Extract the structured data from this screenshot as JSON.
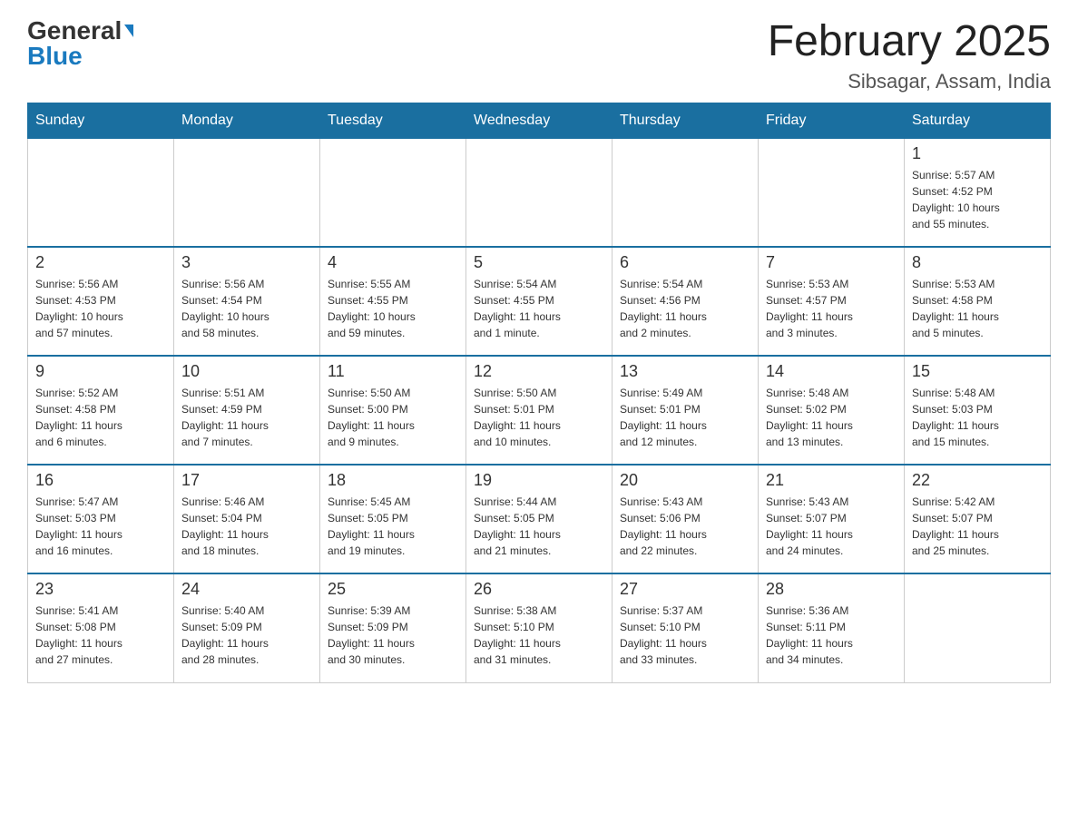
{
  "header": {
    "logo_general": "General",
    "logo_blue": "Blue",
    "month_title": "February 2025",
    "location": "Sibsagar, Assam, India"
  },
  "weekdays": [
    "Sunday",
    "Monday",
    "Tuesday",
    "Wednesday",
    "Thursday",
    "Friday",
    "Saturday"
  ],
  "weeks": [
    [
      {
        "day": "",
        "info": ""
      },
      {
        "day": "",
        "info": ""
      },
      {
        "day": "",
        "info": ""
      },
      {
        "day": "",
        "info": ""
      },
      {
        "day": "",
        "info": ""
      },
      {
        "day": "",
        "info": ""
      },
      {
        "day": "1",
        "info": "Sunrise: 5:57 AM\nSunset: 4:52 PM\nDaylight: 10 hours\nand 55 minutes."
      }
    ],
    [
      {
        "day": "2",
        "info": "Sunrise: 5:56 AM\nSunset: 4:53 PM\nDaylight: 10 hours\nand 57 minutes."
      },
      {
        "day": "3",
        "info": "Sunrise: 5:56 AM\nSunset: 4:54 PM\nDaylight: 10 hours\nand 58 minutes."
      },
      {
        "day": "4",
        "info": "Sunrise: 5:55 AM\nSunset: 4:55 PM\nDaylight: 10 hours\nand 59 minutes."
      },
      {
        "day": "5",
        "info": "Sunrise: 5:54 AM\nSunset: 4:55 PM\nDaylight: 11 hours\nand 1 minute."
      },
      {
        "day": "6",
        "info": "Sunrise: 5:54 AM\nSunset: 4:56 PM\nDaylight: 11 hours\nand 2 minutes."
      },
      {
        "day": "7",
        "info": "Sunrise: 5:53 AM\nSunset: 4:57 PM\nDaylight: 11 hours\nand 3 minutes."
      },
      {
        "day": "8",
        "info": "Sunrise: 5:53 AM\nSunset: 4:58 PM\nDaylight: 11 hours\nand 5 minutes."
      }
    ],
    [
      {
        "day": "9",
        "info": "Sunrise: 5:52 AM\nSunset: 4:58 PM\nDaylight: 11 hours\nand 6 minutes."
      },
      {
        "day": "10",
        "info": "Sunrise: 5:51 AM\nSunset: 4:59 PM\nDaylight: 11 hours\nand 7 minutes."
      },
      {
        "day": "11",
        "info": "Sunrise: 5:50 AM\nSunset: 5:00 PM\nDaylight: 11 hours\nand 9 minutes."
      },
      {
        "day": "12",
        "info": "Sunrise: 5:50 AM\nSunset: 5:01 PM\nDaylight: 11 hours\nand 10 minutes."
      },
      {
        "day": "13",
        "info": "Sunrise: 5:49 AM\nSunset: 5:01 PM\nDaylight: 11 hours\nand 12 minutes."
      },
      {
        "day": "14",
        "info": "Sunrise: 5:48 AM\nSunset: 5:02 PM\nDaylight: 11 hours\nand 13 minutes."
      },
      {
        "day": "15",
        "info": "Sunrise: 5:48 AM\nSunset: 5:03 PM\nDaylight: 11 hours\nand 15 minutes."
      }
    ],
    [
      {
        "day": "16",
        "info": "Sunrise: 5:47 AM\nSunset: 5:03 PM\nDaylight: 11 hours\nand 16 minutes."
      },
      {
        "day": "17",
        "info": "Sunrise: 5:46 AM\nSunset: 5:04 PM\nDaylight: 11 hours\nand 18 minutes."
      },
      {
        "day": "18",
        "info": "Sunrise: 5:45 AM\nSunset: 5:05 PM\nDaylight: 11 hours\nand 19 minutes."
      },
      {
        "day": "19",
        "info": "Sunrise: 5:44 AM\nSunset: 5:05 PM\nDaylight: 11 hours\nand 21 minutes."
      },
      {
        "day": "20",
        "info": "Sunrise: 5:43 AM\nSunset: 5:06 PM\nDaylight: 11 hours\nand 22 minutes."
      },
      {
        "day": "21",
        "info": "Sunrise: 5:43 AM\nSunset: 5:07 PM\nDaylight: 11 hours\nand 24 minutes."
      },
      {
        "day": "22",
        "info": "Sunrise: 5:42 AM\nSunset: 5:07 PM\nDaylight: 11 hours\nand 25 minutes."
      }
    ],
    [
      {
        "day": "23",
        "info": "Sunrise: 5:41 AM\nSunset: 5:08 PM\nDaylight: 11 hours\nand 27 minutes."
      },
      {
        "day": "24",
        "info": "Sunrise: 5:40 AM\nSunset: 5:09 PM\nDaylight: 11 hours\nand 28 minutes."
      },
      {
        "day": "25",
        "info": "Sunrise: 5:39 AM\nSunset: 5:09 PM\nDaylight: 11 hours\nand 30 minutes."
      },
      {
        "day": "26",
        "info": "Sunrise: 5:38 AM\nSunset: 5:10 PM\nDaylight: 11 hours\nand 31 minutes."
      },
      {
        "day": "27",
        "info": "Sunrise: 5:37 AM\nSunset: 5:10 PM\nDaylight: 11 hours\nand 33 minutes."
      },
      {
        "day": "28",
        "info": "Sunrise: 5:36 AM\nSunset: 5:11 PM\nDaylight: 11 hours\nand 34 minutes."
      },
      {
        "day": "",
        "info": ""
      }
    ]
  ]
}
